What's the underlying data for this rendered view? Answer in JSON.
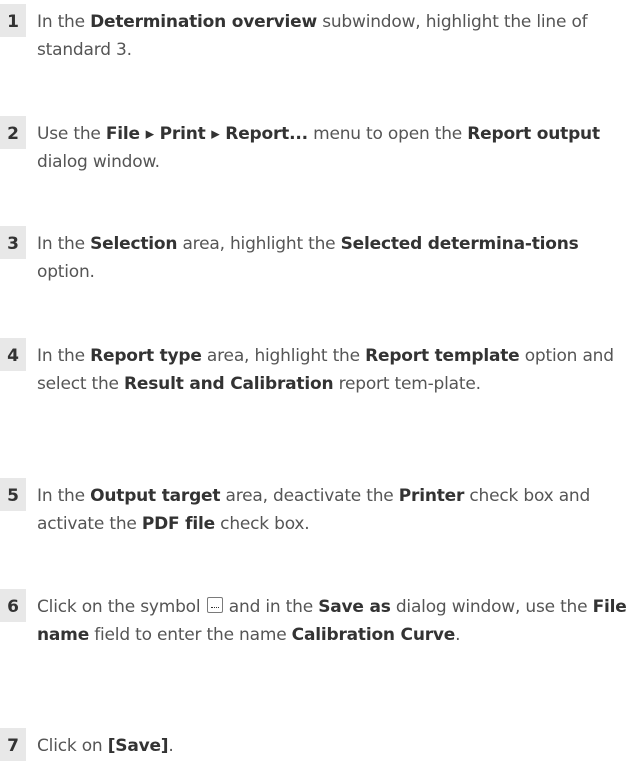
{
  "steps": [
    {
      "number": "1",
      "segments": [
        {
          "text": "In the ",
          "bold": false
        },
        {
          "text": "Determination overview",
          "bold": true
        },
        {
          "text": " subwindow, highlight the line of standard 3.",
          "bold": false
        }
      ]
    },
    {
      "number": "2",
      "segments": [
        {
          "text": "Use the ",
          "bold": false
        },
        {
          "text": "File ▸ Print ▸ Report...",
          "bold": true
        },
        {
          "text": " menu to open the ",
          "bold": false
        },
        {
          "text": "Report output",
          "bold": true
        },
        {
          "text": " dialog window.",
          "bold": false
        }
      ]
    },
    {
      "number": "3",
      "segments": [
        {
          "text": "In the ",
          "bold": false
        },
        {
          "text": "Selection",
          "bold": true
        },
        {
          "text": " area, highlight the ",
          "bold": false
        },
        {
          "text": "Selected determina-tions",
          "bold": true
        },
        {
          "text": " option.",
          "bold": false
        }
      ]
    },
    {
      "number": "4",
      "segments": [
        {
          "text": "In the ",
          "bold": false
        },
        {
          "text": "Report type",
          "bold": true
        },
        {
          "text": " area, highlight the ",
          "bold": false
        },
        {
          "text": "Report template",
          "bold": true
        },
        {
          "text": " option and select the ",
          "bold": false
        },
        {
          "text": "Result and Calibration",
          "bold": true
        },
        {
          "text": " report tem-plate.",
          "bold": false
        }
      ]
    },
    {
      "number": "5",
      "segments": [
        {
          "text": "In the ",
          "bold": false
        },
        {
          "text": "Output target",
          "bold": true
        },
        {
          "text": " area, deactivate the ",
          "bold": false
        },
        {
          "text": "Printer",
          "bold": true
        },
        {
          "text": " check box and activate the ",
          "bold": false
        },
        {
          "text": "PDF file",
          "bold": true
        },
        {
          "text": " check box.",
          "bold": false
        }
      ]
    },
    {
      "number": "6",
      "segments": [
        {
          "text": "Click on the symbol ",
          "bold": false
        },
        {
          "icon": "browse-button-icon"
        },
        {
          "text": " and in the ",
          "bold": false
        },
        {
          "text": "Save as",
          "bold": true
        },
        {
          "text": " dialog window, use the ",
          "bold": false
        },
        {
          "text": "File name",
          "bold": true
        },
        {
          "text": " field to enter the name ",
          "bold": false
        },
        {
          "text": "Calibration Curve",
          "bold": true
        },
        {
          "text": ".",
          "bold": false
        }
      ]
    },
    {
      "number": "7",
      "segments": [
        {
          "text": "Click on ",
          "bold": false
        },
        {
          "text": "[Save]",
          "bold": true
        },
        {
          "text": ".",
          "bold": false
        }
      ]
    }
  ]
}
